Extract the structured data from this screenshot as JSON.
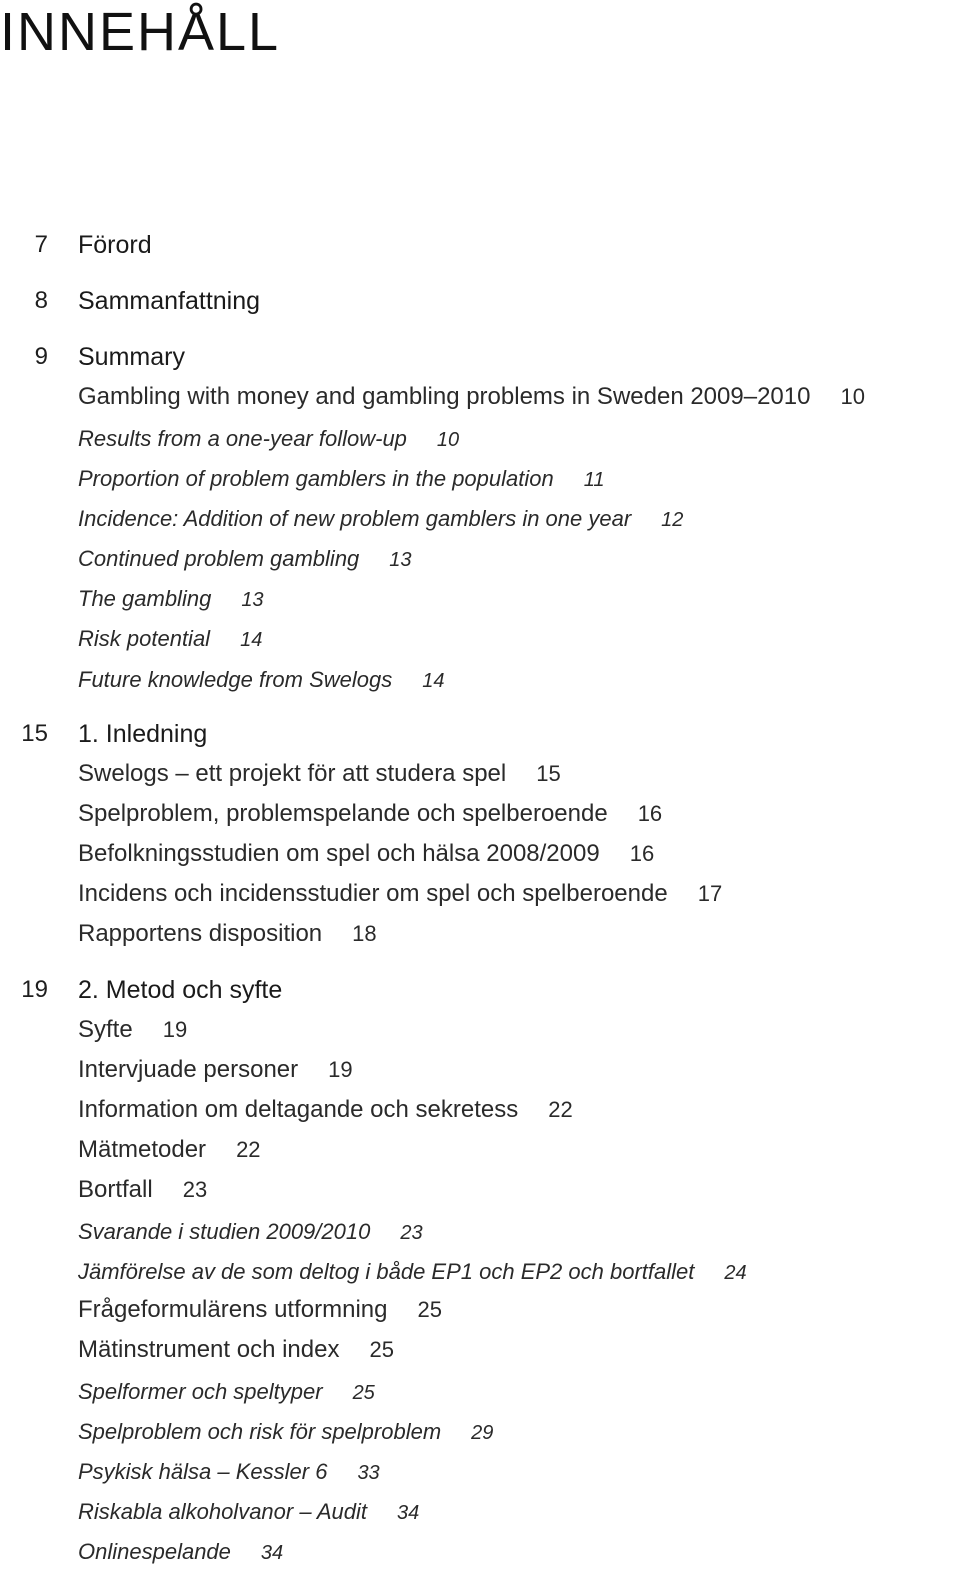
{
  "title": "INNEHÅLL",
  "toc": [
    {
      "level": "chapter",
      "page": "7",
      "label": "Förord"
    },
    {
      "level": "chapter",
      "page": "8",
      "label": "Sammanfattning"
    },
    {
      "level": "chapter",
      "page": "9",
      "label": "Summary"
    },
    {
      "level": "sub",
      "label": "Gambling with money and gambling problems in Sweden 2009–2010",
      "page": "10"
    },
    {
      "level": "subsub",
      "label": "Results from a one-year follow-up",
      "page": "10"
    },
    {
      "level": "subsub",
      "label": "Proportion of problem gamblers in the population",
      "page": "11"
    },
    {
      "level": "subsub",
      "label": "Incidence: Addition of new problem gamblers in one year",
      "page": "12"
    },
    {
      "level": "subsub",
      "label": "Continued problem gambling",
      "page": "13"
    },
    {
      "level": "subsub",
      "label": "The gambling",
      "page": "13"
    },
    {
      "level": "subsub",
      "label": "Risk potential",
      "page": "14"
    },
    {
      "level": "subsub",
      "label": "Future knowledge from Swelogs",
      "page": "14"
    },
    {
      "level": "chapter",
      "page": "15",
      "label": "1. Inledning"
    },
    {
      "level": "sub",
      "label": "Swelogs – ett projekt för att studera spel",
      "page": "15"
    },
    {
      "level": "sub",
      "label": "Spelproblem, problemspelande och spelberoende",
      "page": "16"
    },
    {
      "level": "sub",
      "label": "Befolkningsstudien om spel och hälsa 2008/2009",
      "page": "16"
    },
    {
      "level": "sub",
      "label": "Incidens och incidensstudier om spel och spelberoende",
      "page": "17"
    },
    {
      "level": "sub",
      "label": "Rapportens disposition",
      "page": "18"
    },
    {
      "level": "chapter",
      "page": "19",
      "label": "2. Metod och syfte"
    },
    {
      "level": "sub",
      "label": "Syfte",
      "page": "19"
    },
    {
      "level": "sub",
      "label": "Intervjuade personer",
      "page": "19"
    },
    {
      "level": "sub",
      "label": "Information om deltagande och sekretess",
      "page": "22"
    },
    {
      "level": "sub",
      "label": "Mätmetoder",
      "page": "22"
    },
    {
      "level": "sub",
      "label": "Bortfall",
      "page": "23"
    },
    {
      "level": "subsub",
      "label": "Svarande i studien 2009/2010",
      "page": "23"
    },
    {
      "level": "subsub",
      "label": "Jämförelse av de som deltog i både EP1 och EP2 och bortfallet",
      "page": "24"
    },
    {
      "level": "sub",
      "label": "Frågeformulärens utformning",
      "page": "25"
    },
    {
      "level": "sub",
      "label": "Mätinstrument och index",
      "page": "25"
    },
    {
      "level": "subsub",
      "label": "Spelformer och speltyper",
      "page": "25"
    },
    {
      "level": "subsub",
      "label": "Spelproblem och risk för spelproblem",
      "page": "29"
    },
    {
      "level": "subsub",
      "label": "Psykisk hälsa – Kessler 6",
      "page": "33"
    },
    {
      "level": "subsub",
      "label": "Riskabla alkoholvanor – Audit",
      "page": "34"
    },
    {
      "level": "subsub",
      "label": "Onlinespelande",
      "page": "34"
    }
  ]
}
